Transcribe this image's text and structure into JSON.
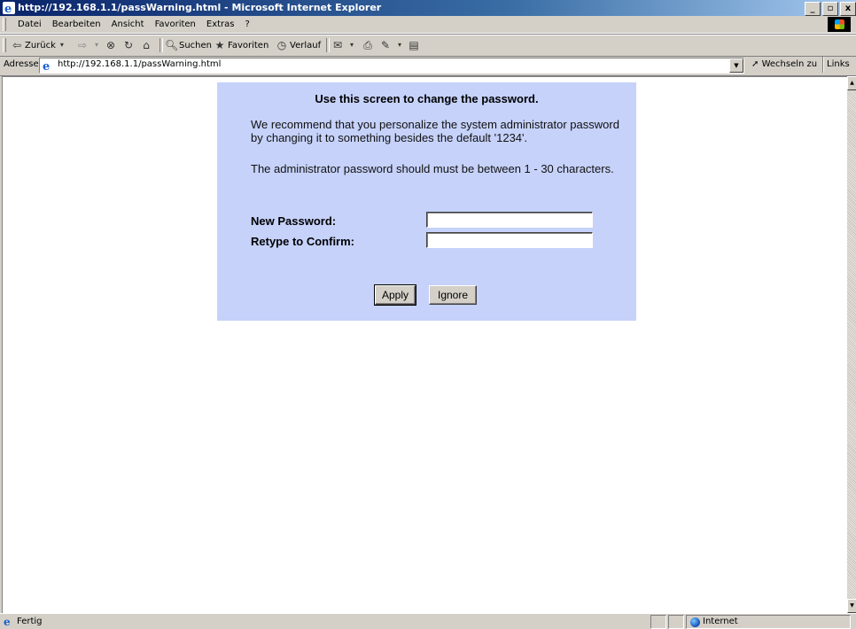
{
  "window": {
    "title": "http://192.168.1.1/passWarning.html - Microsoft Internet Explorer",
    "buttons": [
      "_",
      "▫",
      "x"
    ]
  },
  "menubar": {
    "items": [
      "Datei",
      "Bearbeiten",
      "Ansicht",
      "Favoriten",
      "Extras",
      "?"
    ]
  },
  "toolbar": {
    "back": "Zurück",
    "search": "Suchen",
    "favorites": "Favoriten",
    "history": "Verlauf"
  },
  "address": {
    "label": "Adresse",
    "url": "http://192.168.1.1/passWarning.html",
    "go": "Wechseln zu",
    "links": "Links"
  },
  "page": {
    "heading": "Use this screen to change the password.",
    "para1": "We recommend that you personalize the system administrator password by changing it to something besides the default '1234'.",
    "para2": "The administrator password should must be between 1 - 30 characters.",
    "new_password_label": "New Password:",
    "confirm_label": "Retype to Confirm:",
    "new_password_value": "",
    "confirm_value": "",
    "apply_label": "Apply",
    "ignore_label": "Ignore",
    "panel_color": "#c6d2fa"
  },
  "status": {
    "text": "Fertig",
    "zone": "Internet"
  }
}
